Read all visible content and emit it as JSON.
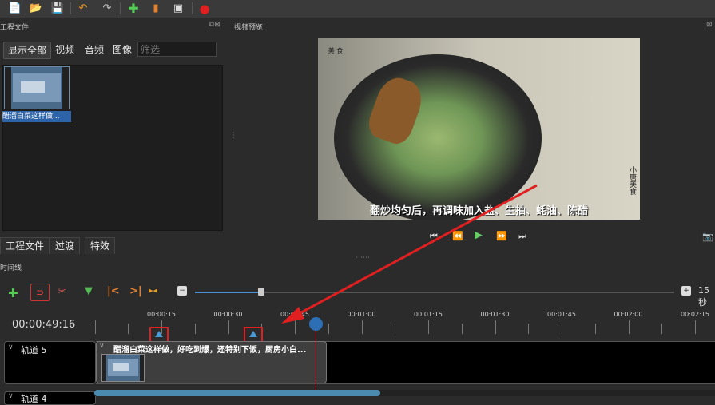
{
  "toolbar": {
    "icons": [
      "new-file-icon",
      "open-file-icon",
      "save-file-icon",
      "undo-icon",
      "redo-icon",
      "add-icon",
      "import-clip-icon",
      "export-video-icon",
      "record-icon"
    ]
  },
  "project_panel": {
    "title": "工程文件",
    "filter_tabs": [
      "显示全部",
      "视频",
      "音频",
      "图像"
    ],
    "filter_placeholder": "筛选",
    "file_label": "醋溜白菜这样做..."
  },
  "preview_panel": {
    "title": "视频预览",
    "subtitle": "翻炒均匀后，再调味加入盐、生抽、蚝油、陈醋",
    "logo_text": "美 食",
    "vertical_logo": "小唐美食"
  },
  "bottom_tabs": [
    "工程文件",
    "过渡",
    "特效"
  ],
  "timeline": {
    "title": "时间线",
    "timecode": "00:00:49:16",
    "zoom_label": "15秒",
    "ruler_labels": [
      "00:00:15",
      "00:00:30",
      "00:00:45",
      "00:01:00",
      "00:01:15",
      "00:01:30",
      "00:01:45",
      "00:02:00",
      "00:02:15"
    ],
    "tracks": [
      {
        "name": "轨道 5"
      },
      {
        "name": "轨道 4"
      }
    ],
    "clip_title": "醋溜白菜这样做，好吃到爆，还特别下饭，厨房小白..."
  },
  "colors": {
    "accent": "#2d6fb5",
    "selection": "#2d63a8",
    "annotation": "#e02020"
  }
}
